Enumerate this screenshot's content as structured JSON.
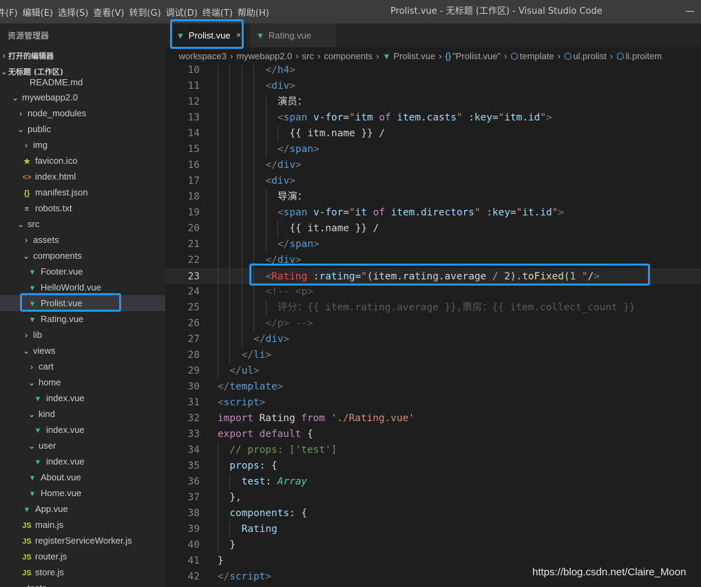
{
  "menu": [
    "件(F)",
    "编辑(E)",
    "选择(S)",
    "查看(V)",
    "转到(G)",
    "调试(D)",
    "终端(T)",
    "帮助(H)"
  ],
  "window_title": "Prolist.vue - 无标题 (工作区) - Visual Studio Code",
  "sidebar": {
    "title": "资源管理器",
    "open_editors": "打开的编辑器",
    "workspace": "无标题 (工作区)",
    "tree": [
      {
        "label": "README.md",
        "icon": "markdown-icon",
        "depth": 2,
        "chev": "",
        "partial": true
      },
      {
        "label": "mywebapp2.0",
        "icon": "",
        "depth": 1,
        "chev": "⌄"
      },
      {
        "label": "node_modules",
        "icon": "",
        "depth": 2,
        "chev": "›"
      },
      {
        "label": "public",
        "icon": "",
        "depth": 2,
        "chev": "⌄"
      },
      {
        "label": "img",
        "icon": "",
        "depth": 3,
        "chev": "›"
      },
      {
        "label": "favicon.ico",
        "icon": "star-icon",
        "depth": 3,
        "chev": ""
      },
      {
        "label": "index.html",
        "icon": "html-icon",
        "depth": 3,
        "chev": ""
      },
      {
        "label": "manifest.json",
        "icon": "json-icon",
        "depth": 3,
        "chev": ""
      },
      {
        "label": "robots.txt",
        "icon": "text-icon",
        "depth": 3,
        "chev": ""
      },
      {
        "label": "src",
        "icon": "",
        "depth": 2,
        "chev": "⌄"
      },
      {
        "label": "assets",
        "icon": "",
        "depth": 3,
        "chev": "›"
      },
      {
        "label": "components",
        "icon": "",
        "depth": 3,
        "chev": "⌄"
      },
      {
        "label": "Footer.vue",
        "icon": "vue-icon",
        "depth": 4,
        "chev": ""
      },
      {
        "label": "HelloWorld.vue",
        "icon": "vue-icon",
        "depth": 4,
        "chev": ""
      },
      {
        "label": "Prolist.vue",
        "icon": "vue-icon",
        "depth": 4,
        "chev": "",
        "selected": true
      },
      {
        "label": "Rating.vue",
        "icon": "vue-icon",
        "depth": 4,
        "chev": ""
      },
      {
        "label": "lib",
        "icon": "",
        "depth": 3,
        "chev": "›"
      },
      {
        "label": "views",
        "icon": "",
        "depth": 3,
        "chev": "⌄"
      },
      {
        "label": "cart",
        "icon": "",
        "depth": 4,
        "chev": "›"
      },
      {
        "label": "home",
        "icon": "",
        "depth": 4,
        "chev": "⌄"
      },
      {
        "label": "index.vue",
        "icon": "vue-icon",
        "depth": 5,
        "chev": ""
      },
      {
        "label": "kind",
        "icon": "",
        "depth": 4,
        "chev": "⌄"
      },
      {
        "label": "index.vue",
        "icon": "vue-icon",
        "depth": 5,
        "chev": ""
      },
      {
        "label": "user",
        "icon": "",
        "depth": 4,
        "chev": "⌄"
      },
      {
        "label": "index.vue",
        "icon": "vue-icon",
        "depth": 5,
        "chev": ""
      },
      {
        "label": "About.vue",
        "icon": "vue-icon",
        "depth": 4,
        "chev": ""
      },
      {
        "label": "Home.vue",
        "icon": "vue-icon",
        "depth": 4,
        "chev": ""
      },
      {
        "label": "App.vue",
        "icon": "vue-icon",
        "depth": 3,
        "chev": ""
      },
      {
        "label": "main.js",
        "icon": "js-icon",
        "depth": 3,
        "chev": ""
      },
      {
        "label": "registerServiceWorker.js",
        "icon": "js-icon",
        "depth": 3,
        "chev": ""
      },
      {
        "label": "router.js",
        "icon": "js-icon",
        "depth": 3,
        "chev": ""
      },
      {
        "label": "store.js",
        "icon": "js-icon",
        "depth": 3,
        "chev": ""
      },
      {
        "label": "tests",
        "icon": "",
        "depth": 2,
        "chev": "›",
        "partial": true
      }
    ]
  },
  "tabs": [
    {
      "label": "Prolist.vue",
      "active": true,
      "close": "×"
    },
    {
      "label": "Rating.vue",
      "active": false
    }
  ],
  "breadcrumb": [
    "workspace3",
    "mywebapp2.0",
    "src",
    "components",
    "Prolist.vue",
    "\"Prolist.vue\"",
    "template",
    "ul.prolist",
    "li.proitem"
  ],
  "code_lines": [
    {
      "n": "10",
      "tokens": [
        [
          "t-br",
          "</"
        ],
        [
          "t-tag",
          "h4"
        ],
        [
          "t-br",
          ">"
        ]
      ],
      "indent": 4
    },
    {
      "n": "11",
      "tokens": [
        [
          "t-br",
          "<"
        ],
        [
          "t-tag",
          "div"
        ],
        [
          "t-br",
          ">"
        ]
      ],
      "indent": 4
    },
    {
      "n": "12",
      "tokens": [
        [
          "",
          "演员："
        ]
      ],
      "indent": 5
    },
    {
      "n": "13",
      "tokens": [
        [
          "t-br",
          "<"
        ],
        [
          "t-tag",
          "span"
        ],
        [
          "",
          " "
        ],
        [
          "t-attr",
          "v-for"
        ],
        [
          "",
          "="
        ],
        [
          "t-str",
          "\""
        ],
        [
          "t-var",
          "itm"
        ],
        [
          "",
          " "
        ],
        [
          "t-kw",
          "of"
        ],
        [
          "",
          " "
        ],
        [
          "t-var",
          "item"
        ],
        [
          "",
          "."
        ],
        [
          "t-var",
          "casts"
        ],
        [
          "t-str",
          "\""
        ],
        [
          "",
          " "
        ],
        [
          "t-attr",
          ":key"
        ],
        [
          "",
          "="
        ],
        [
          "t-str",
          "\""
        ],
        [
          "t-var",
          "itm"
        ],
        [
          "",
          "."
        ],
        [
          "t-var",
          "id"
        ],
        [
          "t-str",
          "\""
        ],
        [
          "t-br",
          ">"
        ]
      ],
      "indent": 5
    },
    {
      "n": "14",
      "tokens": [
        [
          "",
          "{{ itm.name }} /"
        ]
      ],
      "indent": 6
    },
    {
      "n": "15",
      "tokens": [
        [
          "t-br",
          "</"
        ],
        [
          "t-tag",
          "span"
        ],
        [
          "t-br",
          ">"
        ]
      ],
      "indent": 5
    },
    {
      "n": "16",
      "tokens": [
        [
          "t-br",
          "</"
        ],
        [
          "t-tag",
          "div"
        ],
        [
          "t-br",
          ">"
        ]
      ],
      "indent": 4
    },
    {
      "n": "17",
      "tokens": [
        [
          "t-br",
          "<"
        ],
        [
          "t-tag",
          "div"
        ],
        [
          "t-br",
          ">"
        ]
      ],
      "indent": 4
    },
    {
      "n": "18",
      "tokens": [
        [
          "",
          "导演："
        ]
      ],
      "indent": 5
    },
    {
      "n": "19",
      "tokens": [
        [
          "t-br",
          "<"
        ],
        [
          "t-tag",
          "span"
        ],
        [
          "",
          " "
        ],
        [
          "t-attr",
          "v-for"
        ],
        [
          "",
          "="
        ],
        [
          "t-str",
          "\""
        ],
        [
          "t-var",
          "it"
        ],
        [
          "",
          " "
        ],
        [
          "t-kw",
          "of"
        ],
        [
          "",
          " "
        ],
        [
          "t-var",
          "item"
        ],
        [
          "",
          "."
        ],
        [
          "t-var",
          "directors"
        ],
        [
          "t-str",
          "\""
        ],
        [
          "",
          " "
        ],
        [
          "t-attr",
          ":key"
        ],
        [
          "",
          "="
        ],
        [
          "t-str",
          "\""
        ],
        [
          "t-var",
          "it"
        ],
        [
          "",
          "."
        ],
        [
          "t-var",
          "id"
        ],
        [
          "t-str",
          "\""
        ],
        [
          "t-br",
          ">"
        ]
      ],
      "indent": 5
    },
    {
      "n": "20",
      "tokens": [
        [
          "",
          "{{ it.name }} /"
        ]
      ],
      "indent": 6
    },
    {
      "n": "21",
      "tokens": [
        [
          "t-br",
          "</"
        ],
        [
          "t-tag",
          "span"
        ],
        [
          "t-br",
          ">"
        ]
      ],
      "indent": 5
    },
    {
      "n": "22",
      "tokens": [
        [
          "t-br",
          "</"
        ],
        [
          "t-tag",
          "div"
        ],
        [
          "t-br",
          ">"
        ]
      ],
      "indent": 4
    },
    {
      "n": "23",
      "tokens": [
        [
          "t-br",
          "<"
        ],
        [
          "t-red",
          "Rating"
        ],
        [
          "",
          " "
        ],
        [
          "t-attr",
          ":rating"
        ],
        [
          "",
          "="
        ],
        [
          "t-str",
          "\""
        ],
        [
          "",
          "(item.rating.average "
        ],
        [
          "t-kw",
          "/"
        ],
        [
          "",
          " 2)."
        ],
        [
          "t-fn",
          "toFixed"
        ],
        [
          "",
          "("
        ],
        [
          "t-num",
          "1"
        ],
        [
          ")",
          " "
        ],
        [
          "t-str",
          "\""
        ],
        [
          "",
          "/"
        ],
        [
          "t-br",
          ">"
        ]
      ],
      "indent": 4,
      "current": true
    },
    {
      "n": "24",
      "tokens": [
        [
          "t-dim",
          "<!-- <p>"
        ]
      ],
      "indent": 4
    },
    {
      "n": "25",
      "tokens": [
        [
          "t-dim",
          "评分：{{ item.rating.average }},票房：{{ item.collect_count }}"
        ]
      ],
      "indent": 5
    },
    {
      "n": "26",
      "tokens": [
        [
          "t-dim",
          "</p> -->"
        ]
      ],
      "indent": 4
    },
    {
      "n": "27",
      "tokens": [
        [
          "t-br",
          "</"
        ],
        [
          "t-tag",
          "div"
        ],
        [
          "t-br",
          ">"
        ]
      ],
      "indent": 3
    },
    {
      "n": "28",
      "tokens": [
        [
          "t-br",
          "</"
        ],
        [
          "t-tag",
          "li"
        ],
        [
          "t-br",
          ">"
        ]
      ],
      "indent": 2
    },
    {
      "n": "29",
      "tokens": [
        [
          "t-br",
          "</"
        ],
        [
          "t-tag",
          "ul"
        ],
        [
          "t-br",
          ">"
        ]
      ],
      "indent": 1
    },
    {
      "n": "30",
      "tokens": [
        [
          "t-br",
          "</"
        ],
        [
          "t-tag",
          "template"
        ],
        [
          "t-br",
          ">"
        ]
      ],
      "indent": 0
    },
    {
      "n": "31",
      "tokens": [
        [
          "t-br",
          "<"
        ],
        [
          "t-tag",
          "script"
        ],
        [
          "t-br",
          ">"
        ]
      ],
      "indent": 0
    },
    {
      "n": "32",
      "tokens": [
        [
          "t-kw",
          "import"
        ],
        [
          "",
          " Rating "
        ],
        [
          "t-kw",
          "from"
        ],
        [
          "",
          " "
        ],
        [
          "t-str",
          "'./Rating.vue'"
        ]
      ],
      "indent": 0
    },
    {
      "n": "33",
      "tokens": [
        [
          "t-kw",
          "export"
        ],
        [
          "",
          " "
        ],
        [
          "t-kw",
          "default"
        ],
        [
          "",
          " {"
        ]
      ],
      "indent": 0
    },
    {
      "n": "34",
      "tokens": [
        [
          "t-cmt",
          "// props: ['test']"
        ]
      ],
      "indent": 1
    },
    {
      "n": "35",
      "tokens": [
        [
          "t-var",
          "props"
        ],
        [
          "",
          ": {"
        ]
      ],
      "indent": 1
    },
    {
      "n": "36",
      "tokens": [
        [
          "t-var",
          "test"
        ],
        [
          "",
          ": "
        ],
        [
          "t-type",
          "Array"
        ]
      ],
      "indent": 2
    },
    {
      "n": "37",
      "tokens": [
        [
          "",
          "},"
        ]
      ],
      "indent": 1
    },
    {
      "n": "38",
      "tokens": [
        [
          "t-var",
          "components"
        ],
        [
          "",
          ": {"
        ]
      ],
      "indent": 1
    },
    {
      "n": "39",
      "tokens": [
        [
          "t-var",
          "Rating"
        ]
      ],
      "indent": 2
    },
    {
      "n": "40",
      "tokens": [
        [
          "",
          "}"
        ]
      ],
      "indent": 1
    },
    {
      "n": "41",
      "tokens": [
        [
          "",
          "}"
        ]
      ],
      "indent": 0
    },
    {
      "n": "42",
      "tokens": [
        [
          "t-br",
          "</"
        ],
        [
          "t-tag",
          "script"
        ],
        [
          "t-br",
          ">"
        ]
      ],
      "indent": 0
    }
  ],
  "watermark": "https://blog.csdn.net/Claire_Moon"
}
